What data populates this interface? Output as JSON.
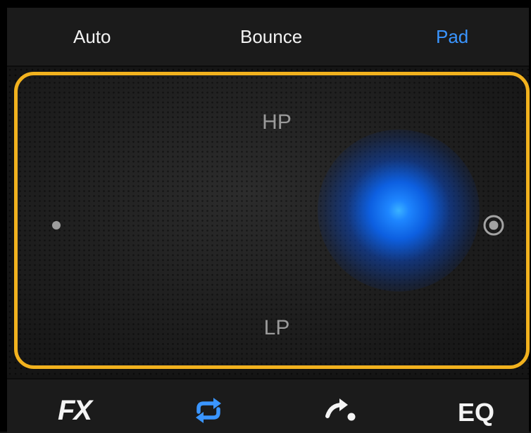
{
  "mode_tabs": {
    "auto": "Auto",
    "bounce": "Bounce",
    "pad": "Pad",
    "active": "Pad"
  },
  "pad": {
    "top_label": "HP",
    "bottom_label": "LP",
    "left_marker_icon": "dot-icon",
    "right_marker_icon": "target-icon"
  },
  "bottom_bar": {
    "fx_label": "FX",
    "loop_icon": "loop-icon",
    "transition_icon": "transition-arrow-icon",
    "eq_label": "EQ"
  },
  "colors": {
    "accent": "#3a95ff",
    "pad_border": "#f2b21e",
    "glow": "#1e86ff"
  }
}
